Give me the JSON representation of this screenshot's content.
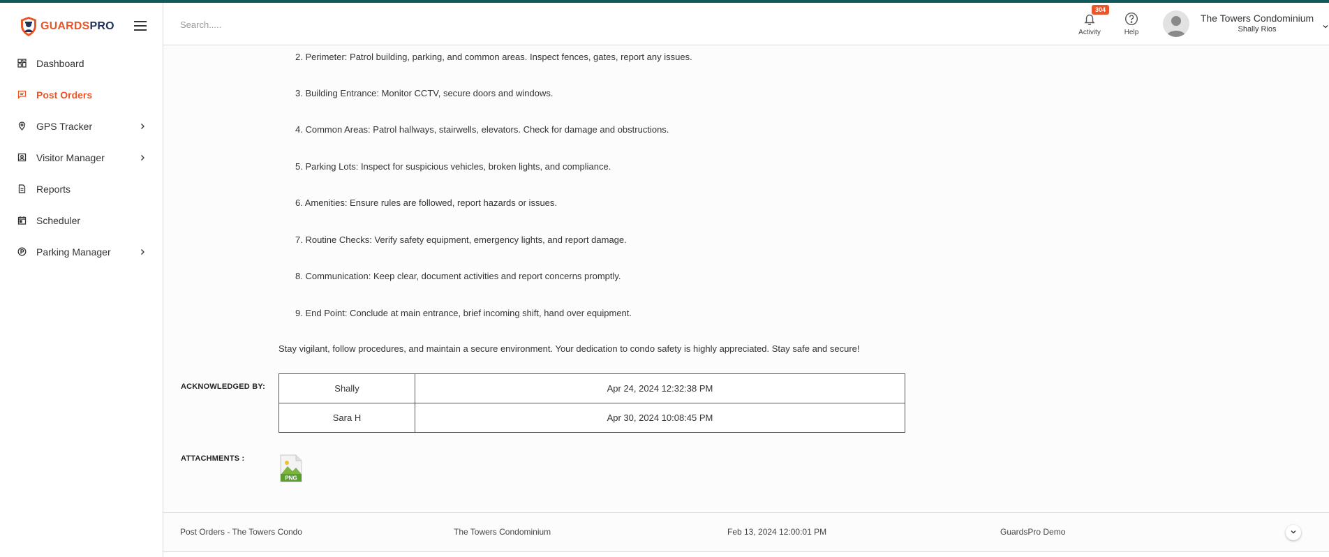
{
  "brand": {
    "part1": "GUARDS",
    "part2": "PRO"
  },
  "colors": {
    "accent": "#e8562a",
    "brand_dark": "#1f3358",
    "top_accent": "#0e5a5a"
  },
  "sidebar": {
    "items": [
      {
        "label": "Dashboard",
        "icon": "dashboard-icon",
        "active": false,
        "has_submenu": false
      },
      {
        "label": "Post Orders",
        "icon": "post-orders-icon",
        "active": true,
        "has_submenu": false
      },
      {
        "label": "GPS Tracker",
        "icon": "location-pin-icon",
        "active": false,
        "has_submenu": true
      },
      {
        "label": "Visitor Manager",
        "icon": "visitor-badge-icon",
        "active": false,
        "has_submenu": true
      },
      {
        "label": "Reports",
        "icon": "document-icon",
        "active": false,
        "has_submenu": false
      },
      {
        "label": "Scheduler",
        "icon": "calendar-icon",
        "active": false,
        "has_submenu": false
      },
      {
        "label": "Parking Manager",
        "icon": "parking-icon",
        "active": false,
        "has_submenu": true
      }
    ]
  },
  "header": {
    "search_placeholder": "Search.....",
    "activity": {
      "label": "Activity",
      "badge": "304"
    },
    "help": {
      "label": "Help"
    },
    "org_name": "The Towers Condominium",
    "user_name": "Shally Rios"
  },
  "post_order": {
    "steps": [
      "2. Perimeter: Patrol building, parking, and common areas. Inspect fences, gates, report any issues.",
      "3. Building Entrance: Monitor CCTV, secure doors and windows.",
      "4. Common Areas: Patrol hallways, stairwells, elevators. Check for damage and obstructions.",
      "5. Parking Lots: Inspect for suspicious vehicles, broken lights, and compliance.",
      "6. Amenities: Ensure rules are followed, report hazards or issues.",
      "7. Routine Checks: Verify safety equipment, emergency lights, and report damage.",
      "8. Communication: Keep clear, document activities and report concerns promptly.",
      "9. End Point: Conclude at main entrance, brief incoming shift, hand over equipment."
    ],
    "closing": "Stay vigilant, follow procedures, and maintain a secure environment. Your dedication to condo safety is highly appreciated. Stay safe and secure!",
    "ack_label": "ACKNOWLEDGED BY:",
    "acknowledgements": [
      {
        "name": "Shally",
        "datetime": "Apr 24, 2024 12:32:38 PM"
      },
      {
        "name": "Sara H",
        "datetime": "Apr 30, 2024 10:08:45 PM"
      }
    ],
    "attachments_label": "ATTACHMENTS :",
    "attachment_type": "PNG"
  },
  "footer_row": {
    "title": "Post Orders - The Towers Condo",
    "property": "The Towers Condominium",
    "date": "Feb 13, 2024 12:00:01 PM",
    "author": "GuardsPro Demo"
  }
}
